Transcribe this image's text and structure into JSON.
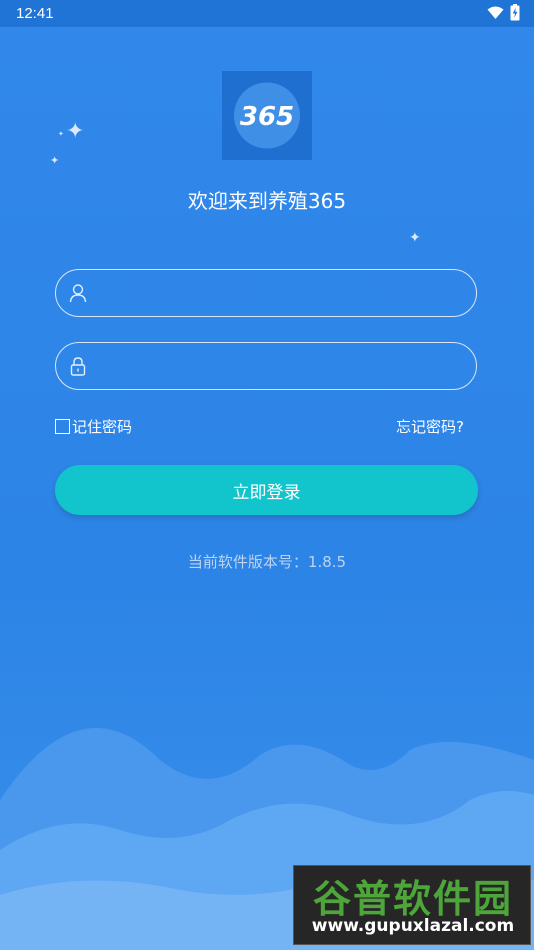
{
  "status_bar": {
    "time": "12:41",
    "icons": [
      "wifi-icon",
      "battery-charging-icon"
    ]
  },
  "app": {
    "logo_text": "365",
    "welcome_title": "欢迎来到养殖365"
  },
  "login_form": {
    "username_placeholder": "",
    "password_placeholder": "",
    "username_icon": "user-icon",
    "password_icon": "lock-icon",
    "remember_label": "记住密码",
    "remember_checked": false,
    "forgot_label": "忘记密码?",
    "submit_label": "立即登录"
  },
  "version_text": "当前软件版本号：1.8.5",
  "watermark": {
    "title": "谷普软件园",
    "url": "www.gupuxlazal.com"
  },
  "colors": {
    "background": "#2f86e6",
    "status_bar": "#1f74d6",
    "button": "#12c5cc",
    "logo_bg": "#1f6fd1"
  }
}
